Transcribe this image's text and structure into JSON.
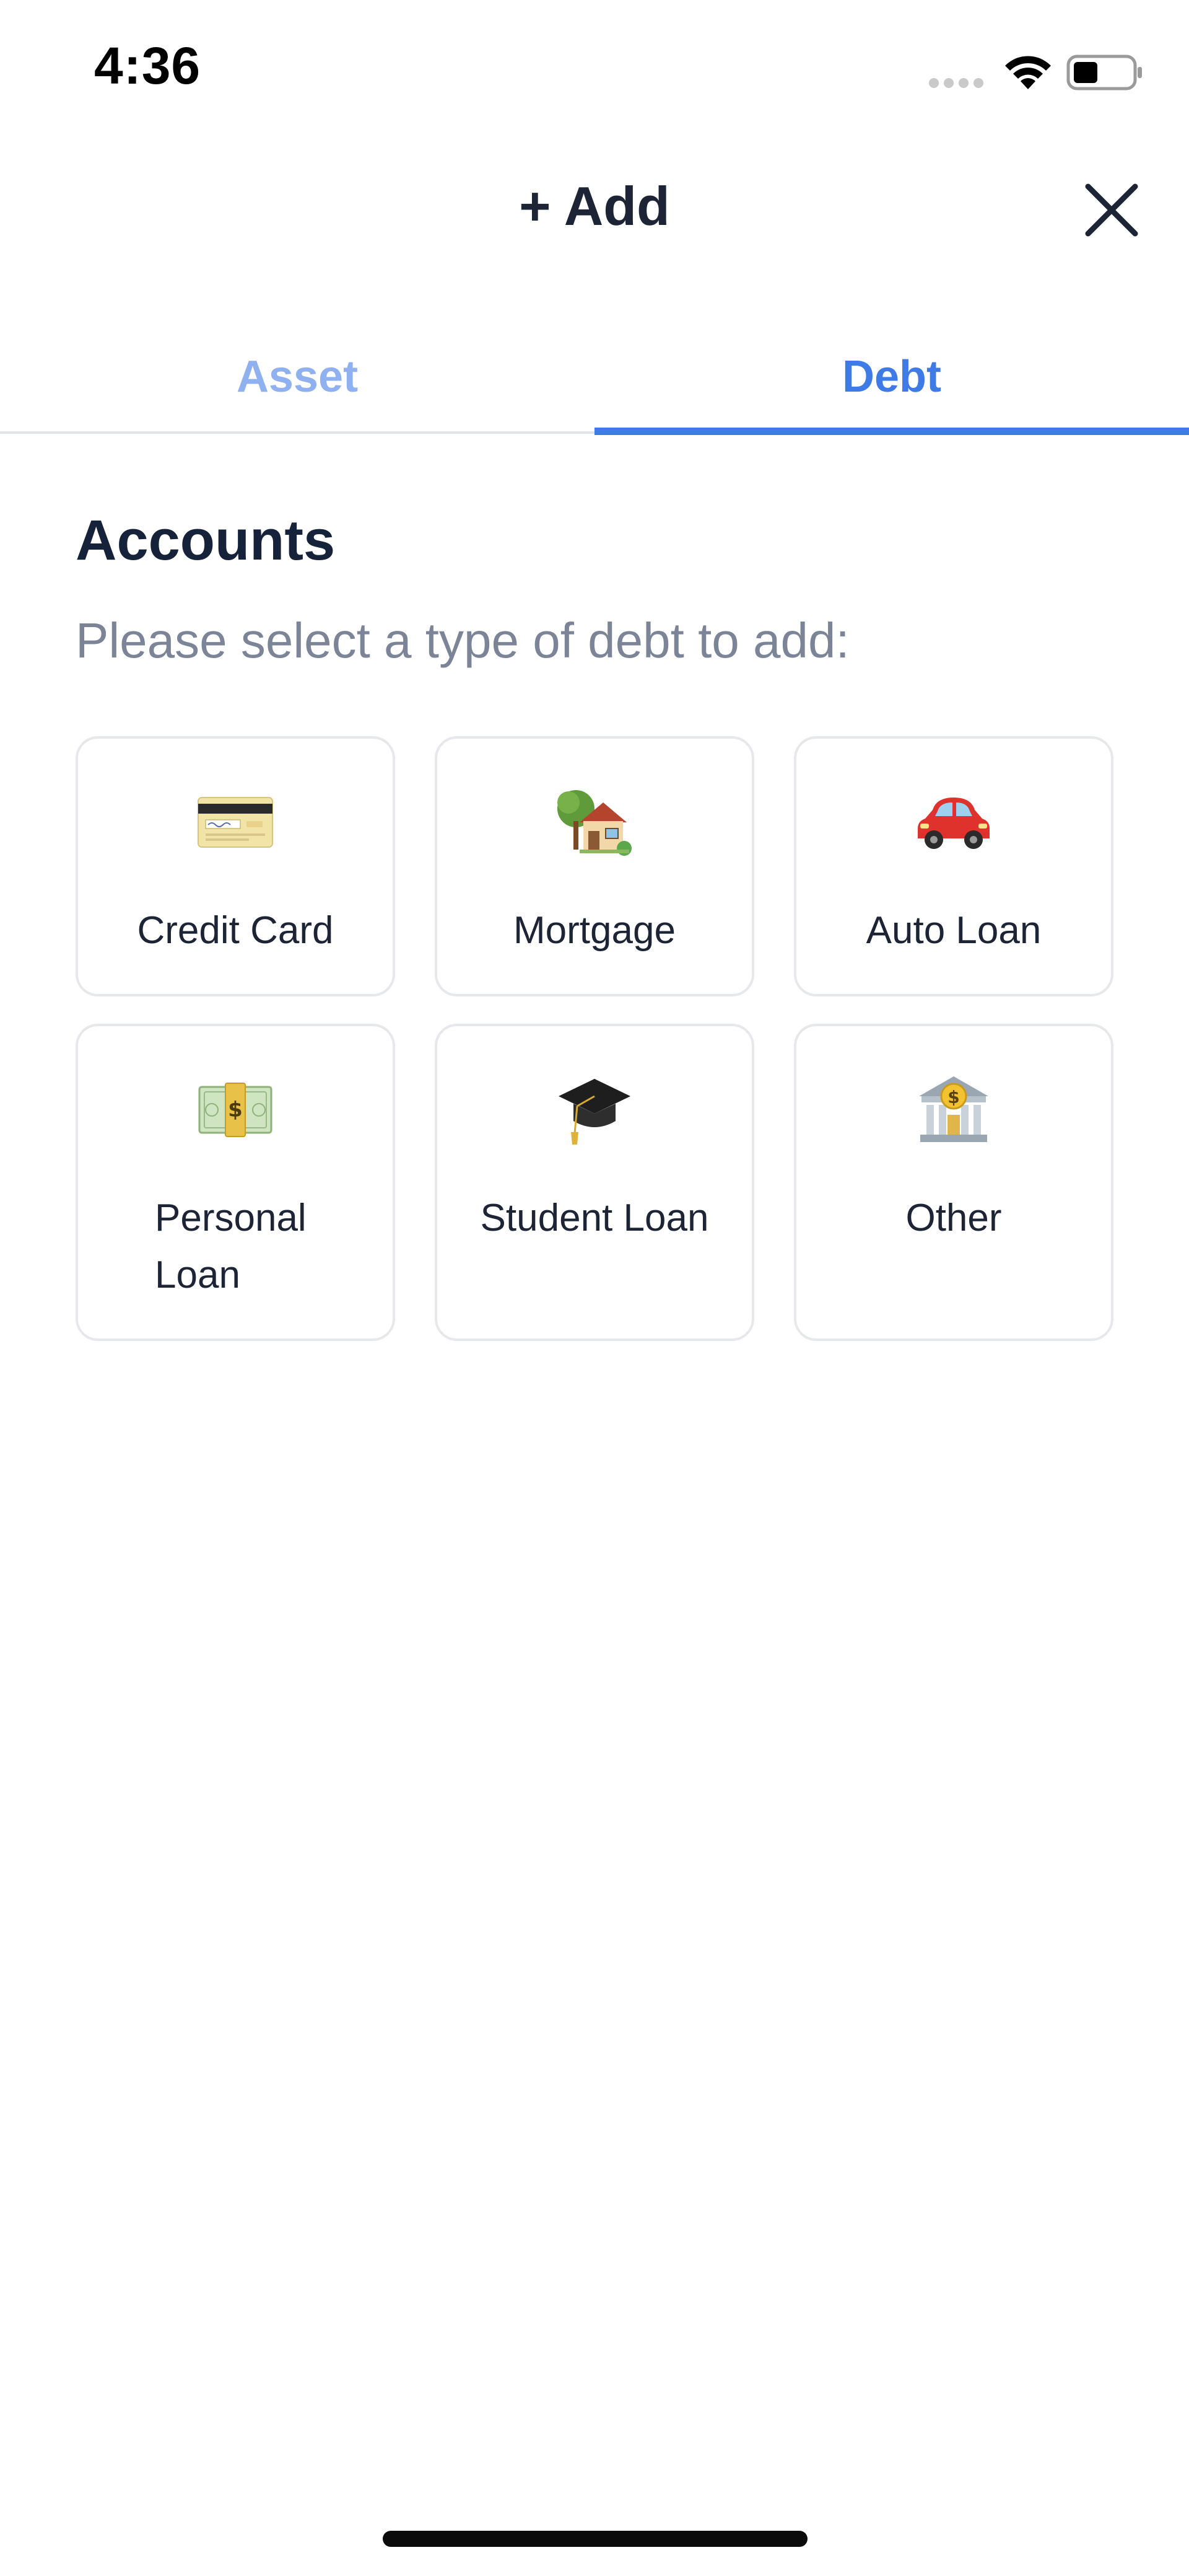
{
  "status_bar": {
    "time": "4:36"
  },
  "header": {
    "title": "+ Add",
    "close_icon": "close-icon"
  },
  "tabs": [
    {
      "label": "Asset",
      "active": false
    },
    {
      "label": "Debt",
      "active": true
    }
  ],
  "section": {
    "title": "Accounts",
    "subtitle": "Please select a type of debt to add:"
  },
  "debt_types": [
    {
      "label": "Credit Card",
      "icon": "credit-card-icon"
    },
    {
      "label": "Mortgage",
      "icon": "house-icon"
    },
    {
      "label": "Auto Loan",
      "icon": "car-icon"
    },
    {
      "label": "Personal Loan",
      "icon": "money-icon"
    },
    {
      "label": "Student Loan",
      "icon": "graduation-cap-icon"
    },
    {
      "label": "Other",
      "icon": "bank-icon"
    }
  ],
  "colors": {
    "accent": "#3f7be6",
    "inactive_tab": "#8fb1f0",
    "text": "#16213a",
    "muted": "#7c8597",
    "card_border": "#e6e8ec"
  }
}
